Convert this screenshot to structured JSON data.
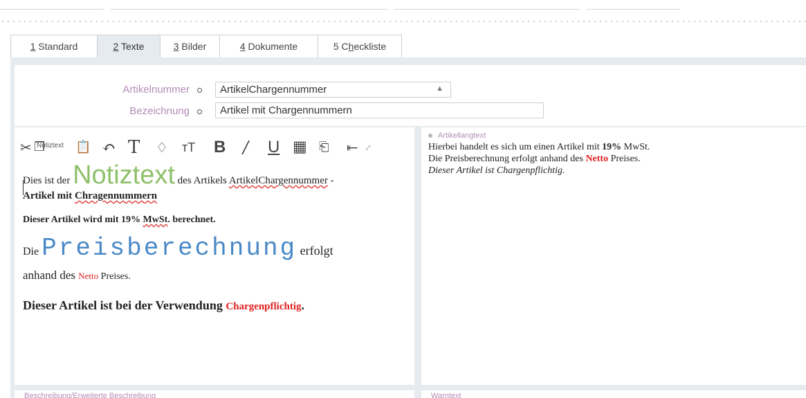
{
  "tabs": [
    {
      "num": "1",
      "label": " Standard"
    },
    {
      "num": "2",
      "label": " Texte"
    },
    {
      "num": "3",
      "label": " Bilder"
    },
    {
      "num": "4",
      "label": " Dokumente"
    },
    {
      "num": "5 C",
      "label": "heckliste",
      "underline": "h"
    }
  ],
  "header": {
    "artikelnummer_label": "Artikelnummer",
    "artikelnummer_value": "ArtikelChargennummer",
    "bezeichnung_label": "Bezeichnung",
    "bezeichnung_value": "Artikel mit Chargennummern"
  },
  "toolbar": {
    "label": "Notiztext"
  },
  "editor": {
    "p1_a": "Dies ist der ",
    "p1_big": "Notiztext",
    "p1_b": " des Artikels ",
    "p1_link": "ArtikelChargennummer",
    "p1_c": " -",
    "p1_d": "Artikel mit ",
    "p1_e": "Chragennummern",
    "p2_a": "Dieser Artikel wird mit 19% ",
    "p2_b": "MwSt",
    "p2_c": ". berechnet.",
    "p3_a": "Die ",
    "p3_big": "Preisberechnung",
    "p3_b": " erfolgt",
    "p3_c": "anhand des ",
    "p3_red": "Netto",
    "p3_d": " Preises.",
    "p4_a": "Dieser Artikel ist bei der Verwendung ",
    "p4_red": "Chargenpflichtig",
    "p4_b": "."
  },
  "right_panel": {
    "title": "Artikellangtext",
    "line1_a": "Hierbei handelt es sich um einen Artikel mit ",
    "line1_b": "19%",
    "line1_c": " MwSt.",
    "line2_a": "Die Preisberechnung erfolgt anhand des ",
    "line2_b": "Netto",
    "line2_c": " Preises.",
    "line3": "Dieser Artikel ist Chargenpflichtig."
  },
  "bottom": {
    "left_title": "Beschreibung/Erweiterte Beschreibung",
    "right_title": "Warntext"
  },
  "colors": {
    "accent_label": "#b38cb8",
    "green_text": "#8fc06a",
    "blue_text": "#4a89c7",
    "red_text": "#e02020",
    "frame_bg": "#e6ebf0"
  }
}
